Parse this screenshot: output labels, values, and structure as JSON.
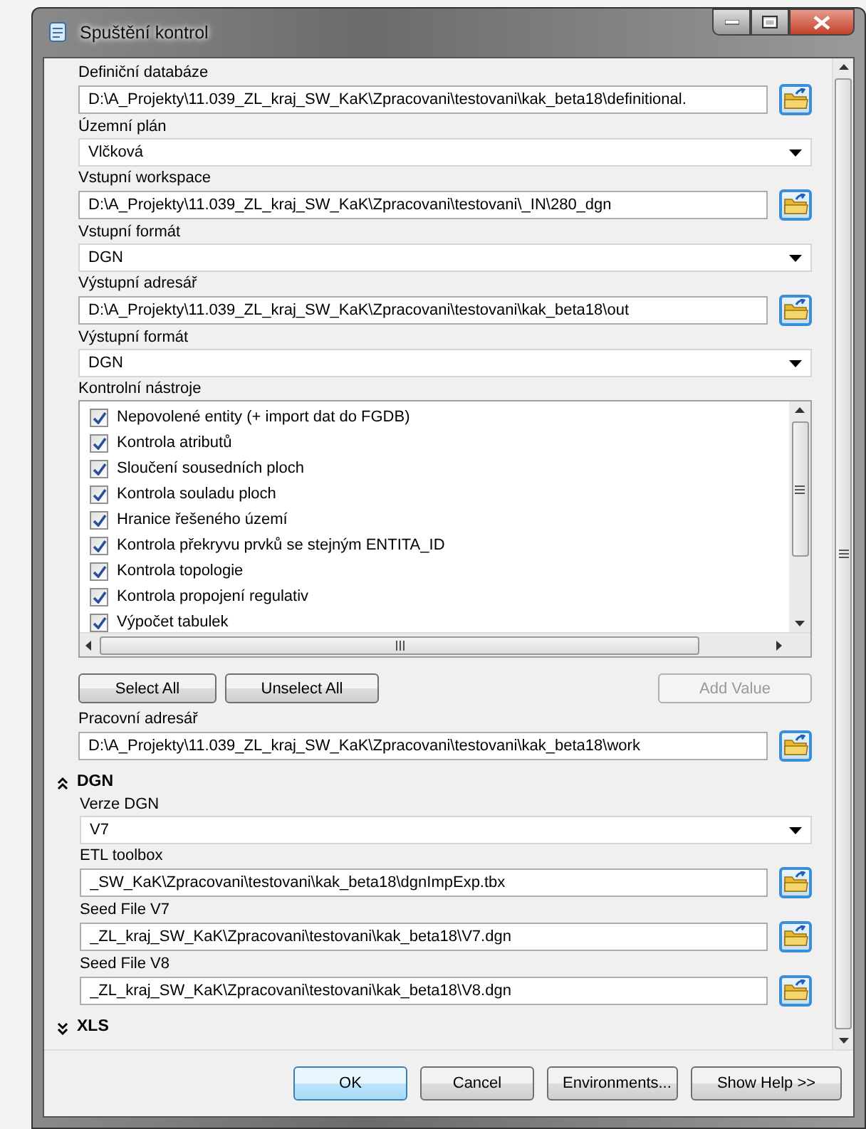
{
  "window": {
    "title": "Spuštění kontrol"
  },
  "fields_top": [
    {
      "kind": "path",
      "label": "Definiční databáze",
      "value": "D:\\A_Projekty\\11.039_ZL_kraj_SW_KaK\\Zpracovani\\testovani\\kak_beta18\\definitional."
    },
    {
      "kind": "dropdown",
      "label": "Územní plán",
      "value": "Vlčková"
    },
    {
      "kind": "path",
      "label": "Vstupní workspace",
      "value": "D:\\A_Projekty\\11.039_ZL_kraj_SW_KaK\\Zpracovani\\testovani\\_IN\\280_dgn"
    },
    {
      "kind": "dropdown",
      "label": "Vstupní formát",
      "value": "DGN"
    },
    {
      "kind": "path",
      "label": "Výstupní adresář",
      "value": "D:\\A_Projekty\\11.039_ZL_kraj_SW_KaK\\Zpracovani\\testovani\\kak_beta18\\out"
    },
    {
      "kind": "dropdown",
      "label": "Výstupní formát",
      "value": "DGN"
    }
  ],
  "tools": {
    "label": "Kontrolní nástroje",
    "items": [
      {
        "label": "Nepovolené entity (+ import dat do FGDB)",
        "checked": true
      },
      {
        "label": "Kontrola atributů",
        "checked": true
      },
      {
        "label": "Sloučení sousedních ploch",
        "checked": true
      },
      {
        "label": "Kontrola souladu ploch",
        "checked": true
      },
      {
        "label": "Hranice řešeného území",
        "checked": true
      },
      {
        "label": "Kontrola překryvu prvků se stejným ENTITA_ID",
        "checked": true
      },
      {
        "label": "Kontrola topologie",
        "checked": true
      },
      {
        "label": "Kontrola propojení regulativ",
        "checked": true
      },
      {
        "label": "Výpočet tabulek",
        "checked": true
      }
    ]
  },
  "tool_buttons": [
    {
      "label": "Select All",
      "disabled": false
    },
    {
      "label": "Unselect All",
      "disabled": false
    },
    {
      "label": "Add Value",
      "disabled": true
    }
  ],
  "fields_bottom": [
    {
      "kind": "path",
      "label": "Pracovní adresář",
      "value": "D:\\A_Projekty\\11.039_ZL_kraj_SW_KaK\\Zpracovani\\testovani\\kak_beta18\\work"
    }
  ],
  "sections": [
    {
      "title": "DGN",
      "expanded": true,
      "fields": [
        {
          "kind": "dropdown",
          "label": "Verze DGN",
          "value": "V7"
        },
        {
          "kind": "path",
          "label": "ETL toolbox",
          "value": "_SW_KaK\\Zpracovani\\testovani\\kak_beta18\\dgnImpExp.tbx"
        },
        {
          "kind": "path",
          "label": "Seed File V7",
          "value": "_ZL_kraj_SW_KaK\\Zpracovani\\testovani\\kak_beta18\\V7.dgn"
        },
        {
          "kind": "path",
          "label": "Seed File V8",
          "value": "_ZL_kraj_SW_KaK\\Zpracovani\\testovani\\kak_beta18\\V8.dgn"
        }
      ]
    },
    {
      "title": "XLS",
      "expanded": false
    }
  ],
  "buttons": [
    {
      "label": "OK",
      "default": true
    },
    {
      "label": "Cancel",
      "default": false
    },
    {
      "label": "Environments...",
      "default": false
    },
    {
      "label": "Show Help >>",
      "default": false
    }
  ]
}
